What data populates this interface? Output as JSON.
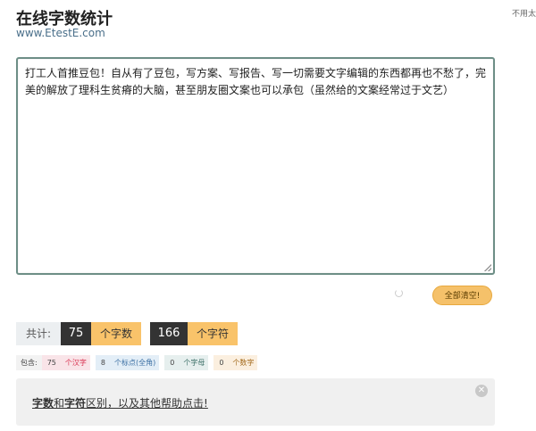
{
  "header": {
    "title": "在线字数统计",
    "url": "www.EtestE.com",
    "top_right_text": "不用太"
  },
  "editor": {
    "text": "打工人首推豆包！自从有了豆包，写方案、写报告、写一切需要文字编辑的东西都再也不愁了，完美的解放了理科生贫瘠的大脑，甚至朋友圈文案也可以承包（虽然给的文案经常过于文艺）"
  },
  "actions": {
    "clear_label": "全部清空!"
  },
  "totals": {
    "label": "共计:",
    "char_count": "75",
    "char_unit": "个字数",
    "symbol_count": "166",
    "symbol_unit": "个字符"
  },
  "details": {
    "prefix": "包含:",
    "items": [
      {
        "count": "75",
        "unit": "个汉字"
      },
      {
        "count": "8",
        "unit": "个标点(全角)"
      },
      {
        "count": "0",
        "unit": "个字母"
      },
      {
        "count": "0",
        "unit": "个数字"
      }
    ],
    "colors": [
      "#f9e4e8",
      "#e3eef7",
      "#e6efee",
      "#fbefdf"
    ],
    "text_colors": [
      "#d9304f",
      "#3b6fa3",
      "#3d7068",
      "#a36a1c"
    ]
  },
  "help": {
    "part1": "字数",
    "part2": "和",
    "part3": "字符",
    "part4": "区别，以及其他帮助点击!",
    "close_icon": "close-icon"
  }
}
